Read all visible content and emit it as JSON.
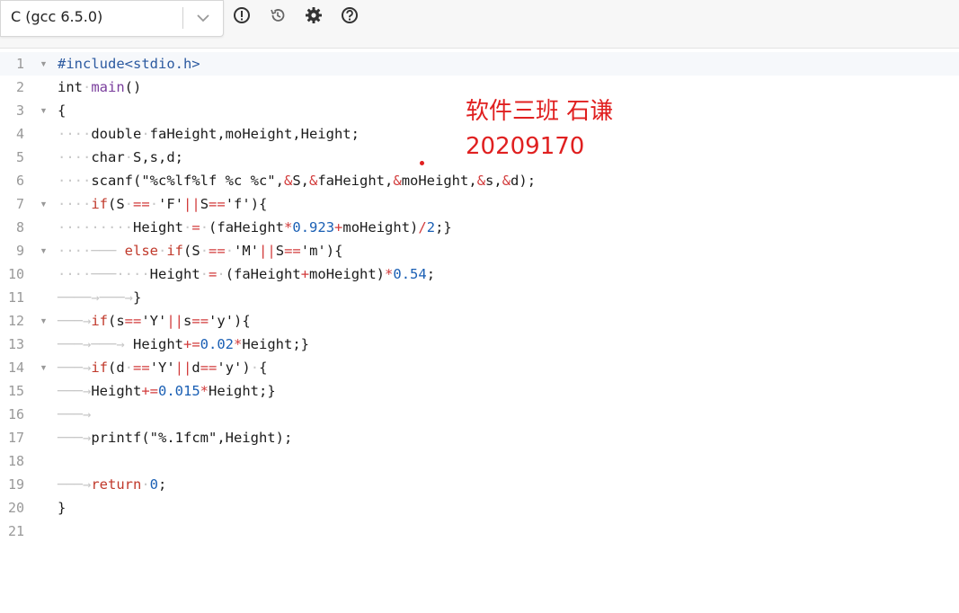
{
  "toolbar": {
    "language_label": "C (gcc 6.5.0)",
    "icons": [
      "chevron-down-icon",
      "alert-icon",
      "history-icon",
      "gear-icon",
      "help-icon"
    ]
  },
  "editor": {
    "lines": [
      {
        "n": "1"
      },
      {
        "n": "2"
      },
      {
        "n": "3"
      },
      {
        "n": "4"
      },
      {
        "n": "5"
      },
      {
        "n": "6"
      },
      {
        "n": "7"
      },
      {
        "n": "8"
      },
      {
        "n": "9"
      },
      {
        "n": "10"
      },
      {
        "n": "11"
      },
      {
        "n": "12"
      },
      {
        "n": "13"
      },
      {
        "n": "14"
      },
      {
        "n": "15"
      },
      {
        "n": "16"
      },
      {
        "n": "17"
      },
      {
        "n": "18"
      },
      {
        "n": "19"
      },
      {
        "n": "20"
      },
      {
        "n": "21"
      }
    ],
    "code": {
      "l1": "#include<stdio.h>",
      "l2": [
        "int",
        "main",
        "()"
      ],
      "l3": "{",
      "l4": [
        "double",
        "faHeight,moHeight,Height;"
      ],
      "l5": [
        "char",
        "S,s,d;"
      ],
      "l6": [
        "scanf(",
        "\"%c%lf%lf %c %c\"",
        ",",
        "&",
        "S,",
        "&",
        "faHeight,",
        "&",
        "moHeight,",
        "&",
        "s,",
        "&",
        "d);"
      ],
      "l7": [
        "if",
        "(S",
        "==",
        "'F'",
        "||",
        "S",
        "==",
        "'f'",
        "){"
      ],
      "l8": [
        "Height",
        "=",
        "(faHeight",
        "*",
        "0.923",
        "+",
        "moHeight)",
        "/",
        "2",
        ";}"
      ],
      "l9": [
        "else",
        "if",
        "(S",
        "==",
        "'M'",
        "||",
        "S",
        "==",
        "'m'",
        "){"
      ],
      "l10": [
        "Height",
        "=",
        "(faHeight",
        "+",
        "moHeight)",
        "*",
        "0.54",
        ";"
      ],
      "l11": "}",
      "l12": [
        "if",
        "(s",
        "==",
        "'Y'",
        "||",
        "s",
        "==",
        "'y'",
        "){"
      ],
      "l13": [
        "Height",
        "+=",
        "0.02",
        "*",
        "Height;}"
      ],
      "l14": [
        "if",
        "(d",
        "==",
        "'Y'",
        "||",
        "d",
        "==",
        "'y'",
        ")",
        "{"
      ],
      "l15": [
        "Height",
        "+=",
        "0.015",
        "*",
        "Height;}"
      ],
      "l17": [
        "printf(",
        "\"%.1fcm\"",
        ",Height);"
      ],
      "l19": [
        "return",
        "0",
        ";"
      ],
      "l20": "}"
    }
  },
  "annotation": {
    "line1": "软件三班 石谦",
    "line2": "20209170"
  },
  "colors": {
    "annotation": "#e02020",
    "keyword": "#c0392b",
    "number": "#1a5fb4",
    "preprocessor": "#2c5aa0"
  }
}
